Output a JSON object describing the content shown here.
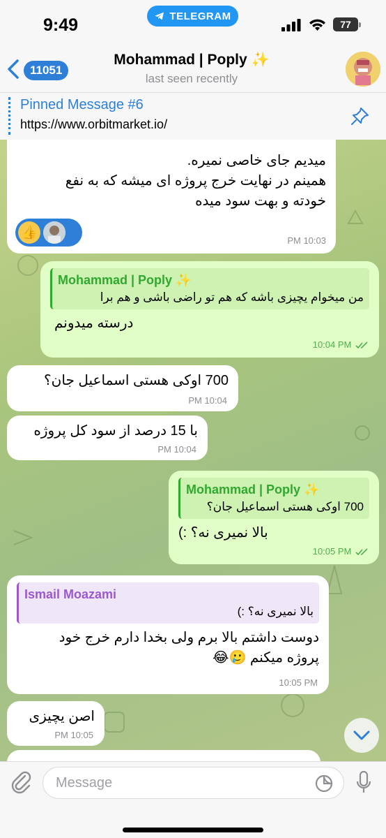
{
  "status": {
    "time": "9:49",
    "app_pill": "TELEGRAM",
    "battery": "77"
  },
  "header": {
    "back_count": "11051",
    "title": "Mohammad | Poply ✨",
    "subtitle": "last seen recently"
  },
  "pinned": {
    "title": "Pinned Message #6",
    "text": "https://www.orbitmarket.io/"
  },
  "messages": [
    {
      "lines": [
        "میدیم جای خاصی نمیره.",
        "همینم در نهایت خرج پروژه ای میشه که به نفع",
        "خودته و بهت سود میده"
      ],
      "time": "10:03 PM",
      "reaction": "👍"
    },
    {
      "reply_name": "Mohammad | Poply ✨",
      "reply_text": "من میخوام یچیزی باشه که هم تو راضی باشی و هم برا",
      "text": "درسته میدونم",
      "time": "10:04 PM"
    },
    {
      "text": "700 اوکی هستی اسماعیل جان؟",
      "time": "10:04 PM"
    },
    {
      "text": "با 15 درصد از سود کل پروژه",
      "time": "10:04 PM"
    },
    {
      "reply_name": "Mohammad | Poply ✨",
      "reply_text": "700 اوکی هستی اسماعیل جان؟",
      "text": "بالا نمیری نه؟ :)",
      "time": "10:05 PM"
    },
    {
      "reply_name": "Ismail Moazami",
      "reply_text": "بالا نمیری نه؟ :)",
      "lines": [
        "دوست داشتم بالا برم ولی بخدا دارم خرج خود",
        "پروژه میکنم 🥲😂"
      ],
      "time": "10:05 PM"
    },
    {
      "text": "اصن یچیزی",
      "time": "10:05 PM"
    }
  ],
  "input": {
    "placeholder": "Message"
  },
  "colors": {
    "accent": "#2d7fd8",
    "outgoing_bubble": "#e1fec6",
    "incoming_bubble": "#ffffff",
    "reply_green": "#31a82f",
    "reply_purple": "#9b59d0"
  }
}
